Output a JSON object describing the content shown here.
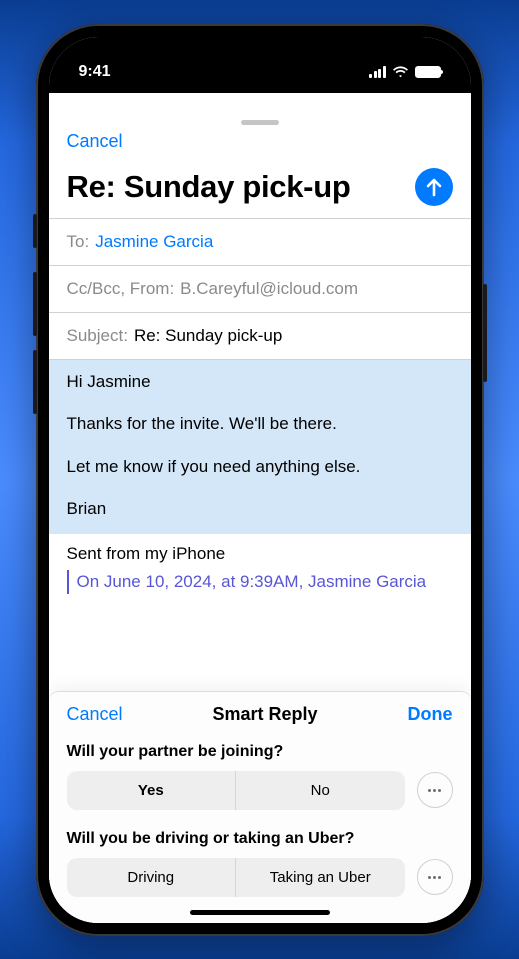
{
  "status": {
    "time": "9:41"
  },
  "compose": {
    "cancel": "Cancel",
    "title": "Re: Sunday pick-up",
    "fields": {
      "to_label": "To:",
      "to_value": "Jasmine Garcia",
      "ccbcc_label": "Cc/Bcc, From:",
      "from_value": "B.Careyful@icloud.com",
      "subject_label": "Subject:",
      "subject_value": "Re: Sunday pick-up"
    },
    "body": {
      "greeting": "Hi Jasmine",
      "line1": "Thanks for the invite. We'll be there.",
      "line2": "Let me know if you need anything else.",
      "signoff": "Brian",
      "signature": "Sent from my iPhone",
      "quote_header": "On June 10, 2024, at 9:39AM, Jasmine Garcia"
    }
  },
  "smart_reply": {
    "cancel": "Cancel",
    "title": "Smart Reply",
    "done": "Done",
    "questions": [
      {
        "prompt": "Will your partner be joining?",
        "options": [
          "Yes",
          "No"
        ]
      },
      {
        "prompt": "Will you be driving or taking an Uber?",
        "options": [
          "Driving",
          "Taking an Uber"
        ]
      }
    ]
  }
}
